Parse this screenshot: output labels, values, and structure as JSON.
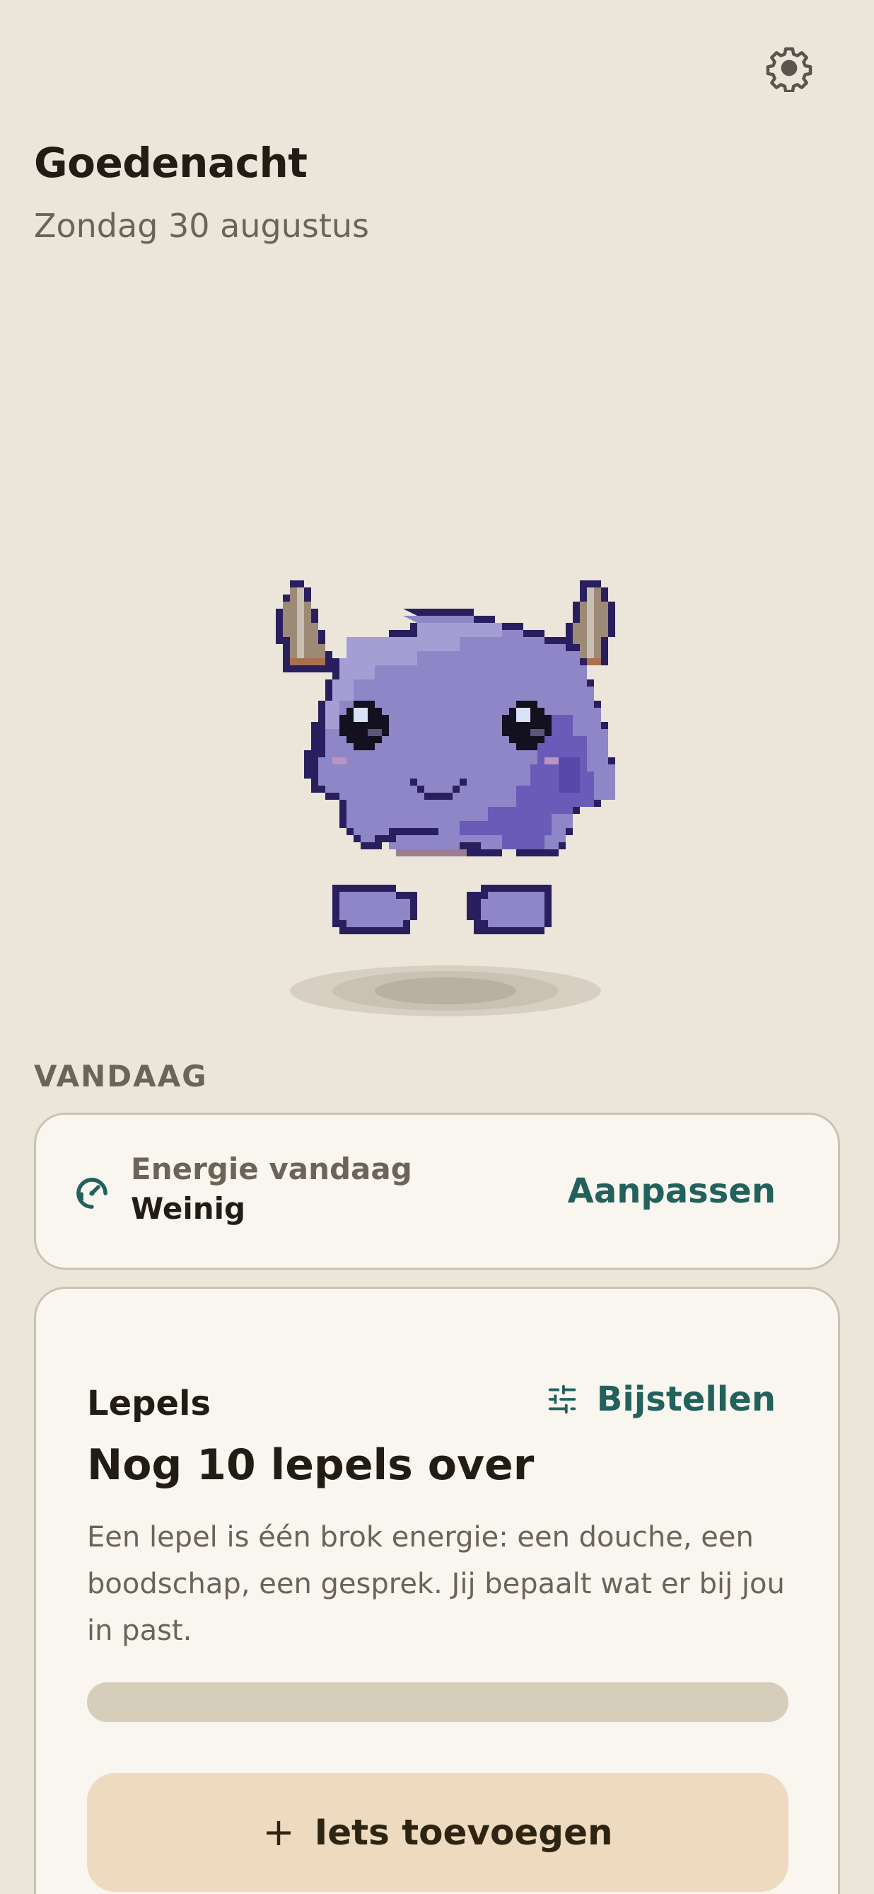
{
  "header": {
    "greeting": "Goedenacht",
    "date": "Zondag 30 augustus",
    "settings_icon": "gear-icon"
  },
  "pet": {
    "description_icon": "purple-horned-monster"
  },
  "today": {
    "section_label": "VANDAAG",
    "energy": {
      "icon": "gauge-icon",
      "title": "Energie vandaag",
      "value": "Weinig",
      "action_label": "Aanpassen"
    }
  },
  "spoons": {
    "title": "Lepels",
    "tune_icon": "sliders-icon",
    "tune_label": "Bijstellen",
    "remaining_text": "Nog 10 lepels over",
    "description": "Een lepel is één brok energie: een douche, een boodschap, een gesprek. Jij bepaalt wat er bij jou in past.",
    "used_fraction": 0,
    "add_icon": "plus-icon",
    "add_label": "Iets toevoegen"
  },
  "colors": {
    "background": "#ece6da",
    "card": "#f9f5ef",
    "accent": "#22615c",
    "add_button": "#eedabe",
    "progress_track": "#d6cdbb"
  }
}
